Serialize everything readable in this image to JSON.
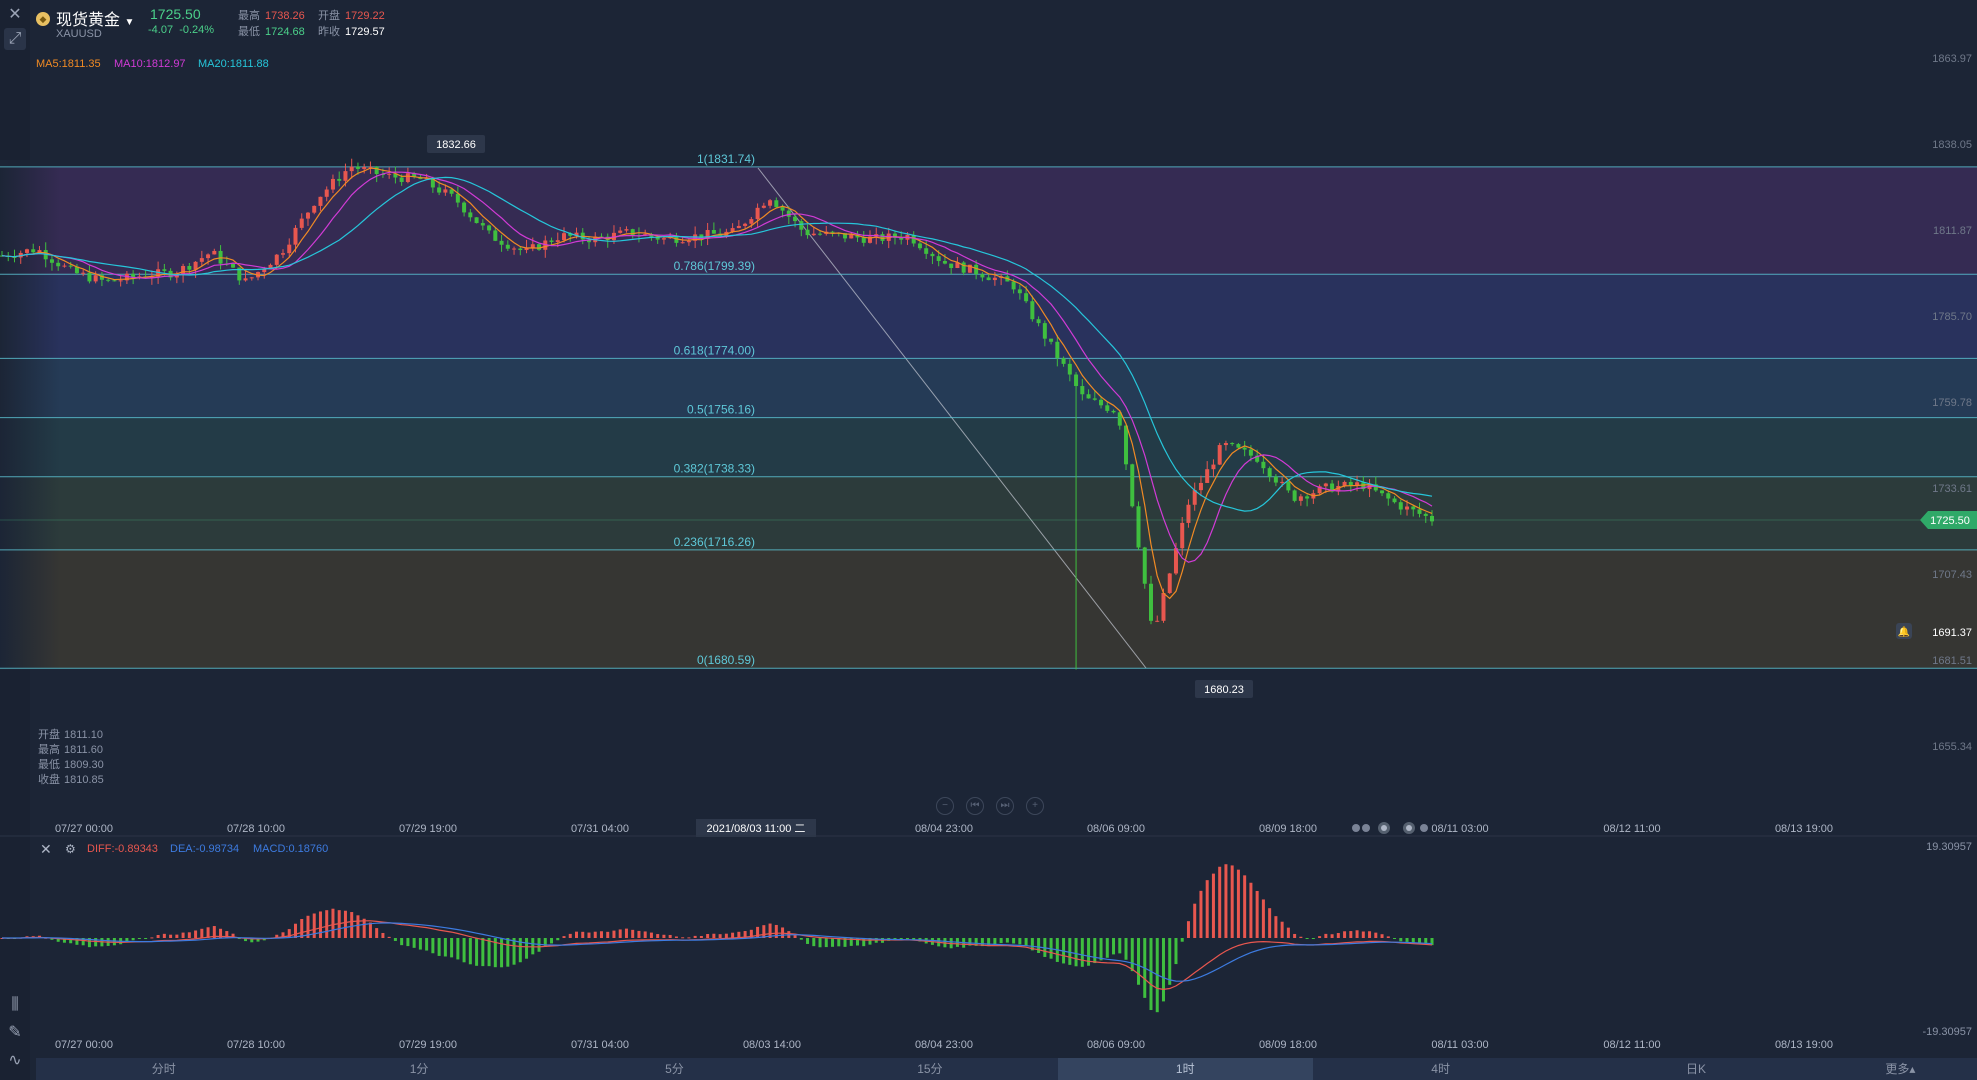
{
  "symbol": {
    "name": "现货黄金",
    "code": "XAUUSD",
    "price": "1725.50",
    "change": "-4.07",
    "change_pct": "-0.24%"
  },
  "stats": {
    "high_label": "最高",
    "high": "1738.26",
    "open_label": "开盘",
    "open": "1729.22",
    "low_label": "最低",
    "low": "1724.68",
    "prev_close_label": "昨收",
    "prev_close": "1729.57"
  },
  "ma": {
    "ma5": "MA5:1811.35",
    "ma10": "MA10:1812.97",
    "ma20": "MA20:1811.88"
  },
  "fib_levels": [
    {
      "label": "1(1831.74)",
      "value": 1831.74
    },
    {
      "label": "0.786(1799.39)",
      "value": 1799.39
    },
    {
      "label": "0.618(1774.00)",
      "value": 1774.0
    },
    {
      "label": "0.5(1756.16)",
      "value": 1756.16
    },
    {
      "label": "0.382(1738.33)",
      "value": 1738.33
    },
    {
      "label": "0.236(1716.26)",
      "value": 1716.26
    },
    {
      "label": "0(1680.59)",
      "value": 1680.59
    }
  ],
  "price_axis": [
    "1863.97",
    "1838.05",
    "1811.87",
    "1785.70",
    "1759.78",
    "1733.61",
    "1707.43",
    "1681.51",
    "1655.34"
  ],
  "current_price_tag": "1725.50",
  "alert_price_tag": "1691.37",
  "high_marker": "1832.66",
  "low_marker": "1680.23",
  "time_axis": [
    "07/27 00:00",
    "07/28 10:00",
    "07/29 19:00",
    "07/31 04:00",
    "08/04 23:00",
    "08/06 09:00",
    "08/09 18:00",
    "08/11 03:00",
    "08/12 11:00",
    "08/13 19:00"
  ],
  "crosshair_time": "2021/08/03 11:00 二",
  "hover_ohlc": {
    "open_label": "开盘",
    "open": "1811.10",
    "high_label": "最高",
    "high": "1811.60",
    "low_label": "最低",
    "low": "1809.30",
    "close_label": "收盘",
    "close": "1810.85"
  },
  "zoom_controls": [
    "−",
    "⏮",
    "⏭",
    "+"
  ],
  "macd": {
    "diff": "DIFF:-0.89343",
    "dea": "DEA:-0.98734",
    "macd": "MACD:0.18760",
    "axis_top": "19.30957",
    "axis_bottom": "-19.30957"
  },
  "macd_time_axis": [
    "07/27 00:00",
    "07/28 10:00",
    "07/29 19:00",
    "07/31 04:00",
    "08/03 14:00",
    "08/04 23:00",
    "08/06 09:00",
    "08/09 18:00",
    "08/11 03:00",
    "08/12 11:00",
    "08/13 19:00"
  ],
  "periods": [
    "分时",
    "1分",
    "5分",
    "15分",
    "1时",
    "4时",
    "日K",
    "更多▴"
  ],
  "active_period": "1时",
  "colors": {
    "up": "#e8574f",
    "down": "#3fbf3f",
    "fib_line": "#5ec8d8",
    "ma5": "#f08a24",
    "ma10": "#d13bd6",
    "ma20": "#26c6da",
    "diff": "#e8574f",
    "dea": "#3d7be0"
  },
  "chart_data": {
    "type": "candlestick",
    "ylim": [
      1655.34,
      1863.97
    ],
    "x": [
      "07/27 00:00",
      "07/28 10:00",
      "07/29 19:00",
      "07/31 04:00",
      "08/03 14:00",
      "08/04 23:00",
      "08/06 09:00",
      "08/09 18:00",
      "08/11 03:00"
    ],
    "close_path": [
      1805,
      1807,
      1800,
      1797,
      1799,
      1800,
      1806,
      1797,
      1806,
      1822,
      1832,
      1829,
      1828,
      1822,
      1811,
      1806,
      1811,
      1810,
      1812,
      1810,
      1811,
      1812,
      1823,
      1812,
      1811,
      1810,
      1811,
      1803,
      1800,
      1796,
      1779,
      1762,
      1758,
      1690,
      1730,
      1748,
      1744,
      1732,
      1735,
      1736,
      1730,
      1725.5
    ]
  }
}
